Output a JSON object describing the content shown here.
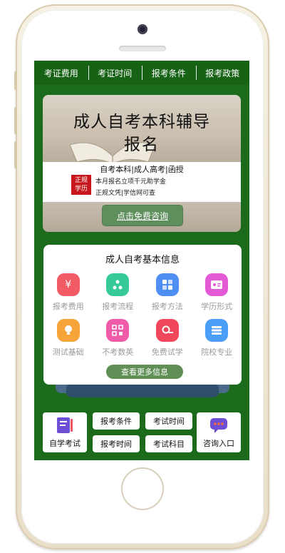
{
  "nav": {
    "items": [
      "考证费用",
      "考证时间",
      "报考条件",
      "报考政策"
    ]
  },
  "banner": {
    "title_line1": "成人自考本科辅导",
    "title_line2": "报名",
    "subtitle": "自考本科|成人高考|函授",
    "badge_line1": "正规",
    "badge_line2": "学历",
    "promo_line1": "本月报名立项千元助学金",
    "promo_line2": "正规文凭|学信网可查",
    "cta": "点击免费咨询"
  },
  "info": {
    "title": "成人自考基本信息",
    "items": [
      {
        "label": "报考费用",
        "icon": "yen-icon",
        "color": "#f25a64"
      },
      {
        "label": "报考流程",
        "icon": "flow-icon",
        "color": "#36c99a"
      },
      {
        "label": "报考方法",
        "icon": "grid-icon",
        "color": "#4f8ef2"
      },
      {
        "label": "学历形式",
        "icon": "id-card-icon",
        "color": "#e35ad6"
      },
      {
        "label": "测试基础",
        "icon": "bulb-icon",
        "color": "#f7a53a"
      },
      {
        "label": "不考数英",
        "icon": "qr-icon",
        "color": "#ef5aa9"
      },
      {
        "label": "免费试学",
        "icon": "search-doc-icon",
        "color": "#f0485a"
      },
      {
        "label": "院校专业",
        "icon": "list-icon",
        "color": "#4a9ef8"
      }
    ],
    "more": "查看更多信息"
  },
  "bottom": {
    "self_study": "自学考试",
    "conditions": "报考条件",
    "exam_time": "考试时间",
    "register_time": "报考时间",
    "exam_subjects": "考试科目",
    "consult": "咨询入口"
  }
}
